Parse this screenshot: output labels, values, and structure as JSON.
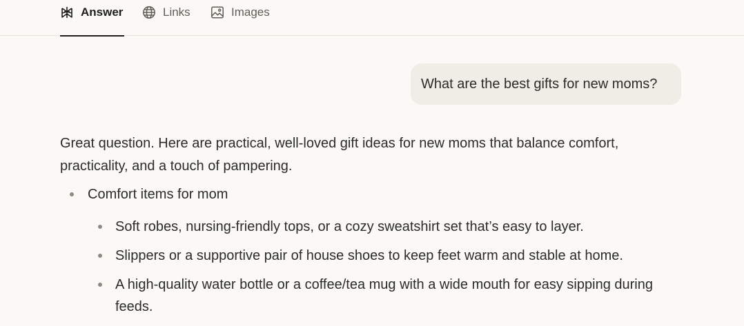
{
  "tabs": [
    {
      "label": "Answer",
      "icon": "perplexity-logo-icon",
      "active": true
    },
    {
      "label": "Links",
      "icon": "globe-icon",
      "active": false
    },
    {
      "label": "Images",
      "icon": "image-icon",
      "active": false
    }
  ],
  "question": "What are the best gifts for new moms?",
  "answer": {
    "intro": "Great question. Here are practical, well-loved gift ideas for new moms that balance comfort, practicality, and a touch of pampering.",
    "sections": [
      {
        "title": "Comfort items for mom",
        "items": [
          "Soft robes, nursing-friendly tops, or a cozy sweatshirt set that’s easy to layer.",
          "Slippers or a supportive pair of house shoes to keep feet warm and stable at home.",
          "A high-quality water bottle or a coffee/tea mug with a wide mouth for easy sipping during feeds."
        ]
      }
    ]
  },
  "colors": {
    "background": "#fbf9f6",
    "bubble": "#f0ede7",
    "text": "#2b2b28",
    "muted": "#5f5d57"
  }
}
